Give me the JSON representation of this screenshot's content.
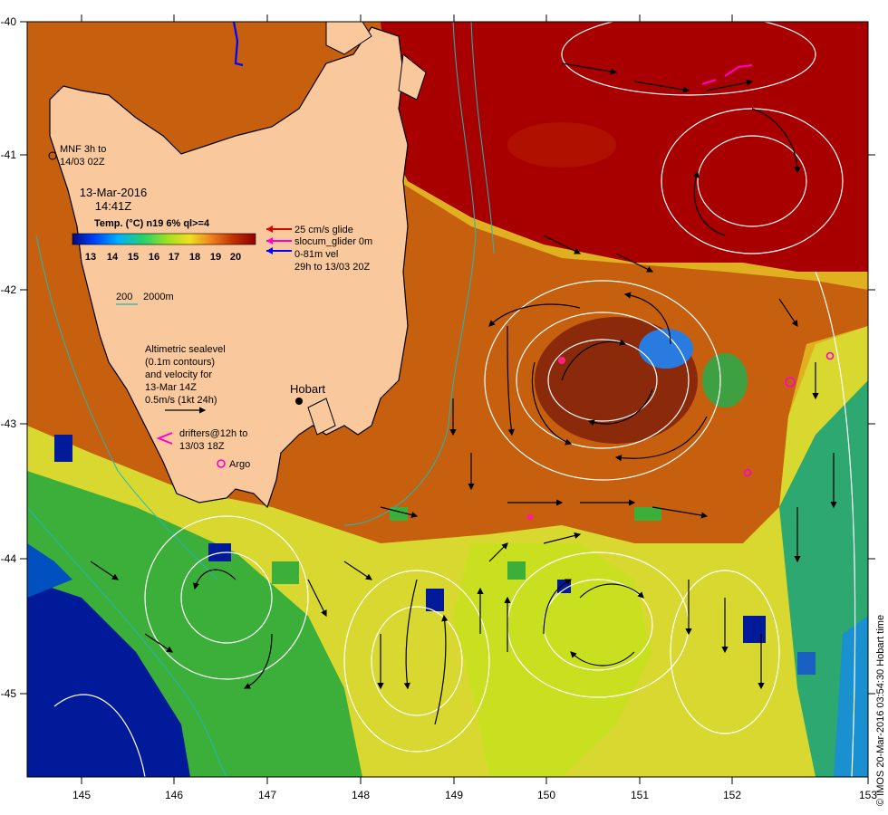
{
  "map": {
    "lon_ticks": [
      "145",
      "146",
      "147",
      "148",
      "149",
      "150",
      "151",
      "152",
      "153"
    ],
    "lat_ticks": [
      "-40",
      "-41",
      "-42",
      "-43",
      "-44",
      "-45"
    ],
    "lon_range": [
      144.5,
      153
    ],
    "lat_range": [
      -40,
      -45.6
    ],
    "colors": {
      "land": "#f9c99d",
      "warm": "#a80000",
      "orange": "#c85a10",
      "yellow": "#e6d530",
      "green": "#4bbf3a",
      "blue": "#001a9a",
      "contour": "#ffffff",
      "bathy": "#20b8b8"
    }
  },
  "legend": {
    "mnf_text_1": "MNF 3h to",
    "mnf_text_2": "14/03 02Z",
    "date": "13-Mar-2016",
    "time": "14:41Z",
    "temp_title": "Temp. (°C) n19 6% ql>=4",
    "colorbar_ticks": [
      "13",
      "14",
      "15",
      "16",
      "17",
      "18",
      "19",
      "20"
    ],
    "glider_1": "25 cm/s glide",
    "glider_2": "slocum_glider 0m",
    "glider_3": "0-81m vel",
    "glider_4": "29h to 13/03 20Z",
    "bathy_200": "200",
    "bathy_2000": "2000m",
    "alt_1": "Altimetric sealevel",
    "alt_2": "(0.1m contours)",
    "alt_3": "and velocity for",
    "alt_4": "13-Mar 14Z",
    "alt_5": "0.5m/s (1kt 24h)",
    "drifters_1": "drifters@12h to",
    "drifters_2": "13/03 18Z",
    "argo": "Argo",
    "hobart": "Hobart"
  },
  "credit": "© IMOS 20-Mar-2016 03:54:30 Hobart time"
}
